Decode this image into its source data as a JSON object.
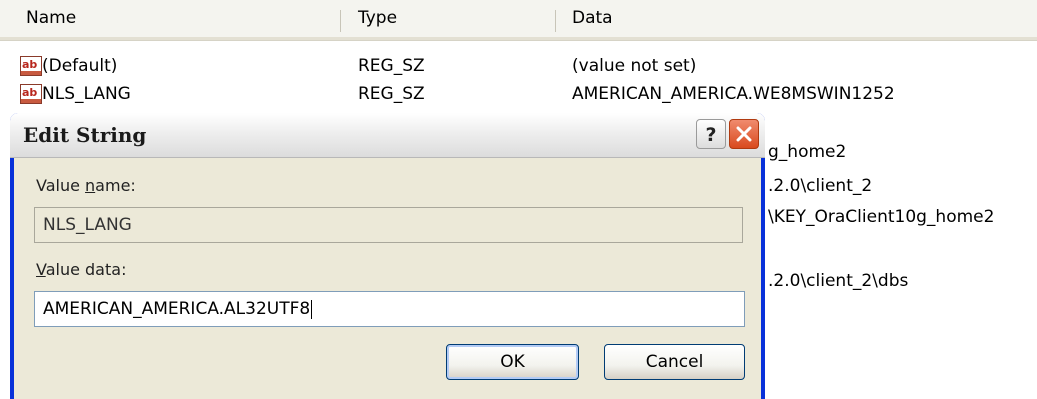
{
  "listview": {
    "columns": {
      "name": "Name",
      "type": "Type",
      "data": "Data"
    },
    "rows": [
      {
        "name": "(Default)",
        "type": "REG_SZ",
        "data": "(value not set)",
        "icon": "string-value-icon"
      },
      {
        "name": "NLS_LANG",
        "type": "REG_SZ",
        "data": "AMERICAN_AMERICA.WE8MSWIN1252",
        "icon": "string-value-icon"
      }
    ],
    "partial_rows": [
      "g_home2",
      ".2.0\\client_2",
      "\\KEY_OraClient10g_home2",
      ".2.0\\client_2\\dbs"
    ]
  },
  "dialog": {
    "title": "Edit String",
    "help_button_label": "?",
    "value_name_label_pre": "Value ",
    "value_name_label_accel": "n",
    "value_name_label_post": "ame:",
    "value_name": "NLS_LANG",
    "value_data_label_accel": "V",
    "value_data_label_post": "alue data:",
    "value_data": "AMERICAN_AMERICA.AL32UTF8",
    "ok_label": "OK",
    "cancel_label": "Cancel"
  },
  "colors": {
    "titlebar_frame": "#0831d9",
    "dialog_face": "#ece9d8",
    "close_button": "#d94a1e"
  }
}
